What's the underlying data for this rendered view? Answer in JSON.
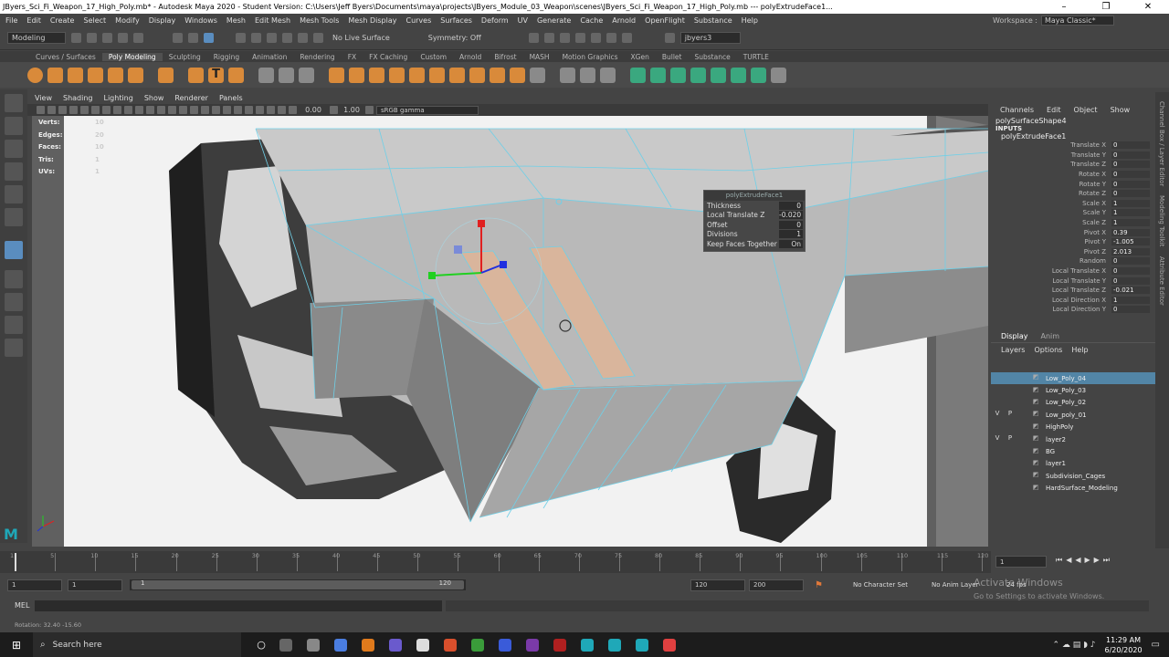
{
  "window": {
    "title": "JByers_Sci_Fi_Weapon_17_High_Poly.mb* - Autodesk Maya 2020 - Student Version: C:\\Users\\Jeff Byers\\Documents\\maya\\projects\\JByers_Module_03_Weapon\\scenes\\JByers_Sci_Fi_Weapon_17_High_Poly.mb --- polyExtrudeFace1..."
  },
  "menus": [
    "File",
    "Edit",
    "Create",
    "Select",
    "Modify",
    "Display",
    "Windows",
    "Mesh",
    "Edit Mesh",
    "Mesh Tools",
    "Mesh Display",
    "Curves",
    "Surfaces",
    "Deform",
    "UV",
    "Generate",
    "Cache",
    "Arnold",
    "OpenFlight",
    "Substance",
    "Help"
  ],
  "workspace": {
    "label": "Workspace :",
    "value": "Maya Classic*"
  },
  "status": {
    "mode": "Modeling",
    "live_surface": "No Live Surface",
    "symmetry": "Symmetry: Off",
    "user": "jbyers3"
  },
  "shelf_tabs": [
    "Curves / Surfaces",
    "Poly Modeling",
    "Sculpting",
    "Rigging",
    "Animation",
    "Rendering",
    "FX",
    "FX Caching",
    "Custom",
    "Arnold",
    "Bifrost",
    "MASH",
    "Motion Graphics",
    "XGen",
    "Bullet",
    "Substance",
    "TURTLE"
  ],
  "active_shelf": "Poly Modeling",
  "viewport_menu": [
    "View",
    "Shading",
    "Lighting",
    "Show",
    "Renderer",
    "Panels"
  ],
  "viewport_toolbar": {
    "val1": "0.00",
    "val2": "1.00",
    "color_space": "sRGB gamma"
  },
  "hud": [
    {
      "label": "Verts:",
      "value": "10"
    },
    {
      "label": "Edges:",
      "value": "20"
    },
    {
      "label": "Faces:",
      "value": "10"
    },
    {
      "label": "Tris:",
      "value": "1"
    },
    {
      "label": "UVs:",
      "value": "1"
    }
  ],
  "popup": {
    "title": "polyExtrudeFace1",
    "rows": [
      {
        "label": "Thickness",
        "value": "0"
      },
      {
        "label": "Local Translate Z",
        "value": "-0.020"
      },
      {
        "label": "Offset",
        "value": "0"
      },
      {
        "label": "Divisions",
        "value": "1"
      },
      {
        "label": "Keep Faces Together",
        "value": "On"
      }
    ]
  },
  "channel_box": {
    "menu": [
      "Channels",
      "Edit",
      "Object",
      "Show"
    ],
    "shape": "polySurfaceShape4",
    "inputs_label": "INPUTS",
    "node": "polyExtrudeFace1",
    "attrs": [
      {
        "name": "Translate X",
        "value": "0"
      },
      {
        "name": "Translate Y",
        "value": "0"
      },
      {
        "name": "Translate Z",
        "value": "0"
      },
      {
        "name": "Rotate X",
        "value": "0"
      },
      {
        "name": "Rotate Y",
        "value": "0"
      },
      {
        "name": "Rotate Z",
        "value": "0"
      },
      {
        "name": "Scale X",
        "value": "1"
      },
      {
        "name": "Scale Y",
        "value": "1"
      },
      {
        "name": "Scale Z",
        "value": "1"
      },
      {
        "name": "Pivot X",
        "value": "0.39"
      },
      {
        "name": "Pivot Y",
        "value": "-1.005"
      },
      {
        "name": "Pivot Z",
        "value": "2.013"
      },
      {
        "name": "Random",
        "value": "0"
      },
      {
        "name": "Local Translate X",
        "value": "0"
      },
      {
        "name": "Local Translate Y",
        "value": "0"
      },
      {
        "name": "Local Translate Z",
        "value": "-0.021"
      },
      {
        "name": "Local Direction X",
        "value": "1"
      },
      {
        "name": "Local Direction Y",
        "value": "0"
      }
    ]
  },
  "layer_editor": {
    "tabs": [
      "Display",
      "Anim"
    ],
    "menu": [
      "Layers",
      "Options",
      "Help"
    ],
    "layers": [
      {
        "name": "Low_Poly_04",
        "v": "",
        "p": "",
        "selected": true
      },
      {
        "name": "Low_Poly_03",
        "v": "",
        "p": ""
      },
      {
        "name": "Low_Poly_02",
        "v": "",
        "p": ""
      },
      {
        "name": "Low_poly_01",
        "v": "V",
        "p": "P"
      },
      {
        "name": "HighPoly",
        "v": "",
        "p": ""
      },
      {
        "name": "layer2",
        "v": "V",
        "p": "P"
      },
      {
        "name": "BG",
        "v": "",
        "p": ""
      },
      {
        "name": "layer1",
        "v": "",
        "p": ""
      },
      {
        "name": "Subdivision_Cages",
        "v": "",
        "p": ""
      },
      {
        "name": "HardSurface_Modeling",
        "v": "",
        "p": ""
      }
    ]
  },
  "side_tabs": [
    "Channel Box / Layer Editor",
    "Modeling Toolkit",
    "Attribute Editor"
  ],
  "timeline": {
    "ticks": [
      "1",
      "5",
      "10",
      "15",
      "20",
      "25",
      "30",
      "35",
      "40",
      "45",
      "50",
      "55",
      "60",
      "65",
      "70",
      "75",
      "80",
      "85",
      "90",
      "95",
      "100",
      "105",
      "110",
      "115",
      "120"
    ],
    "current": "1"
  },
  "range": {
    "start": "1",
    "inner_start": "1",
    "slider_start": "1",
    "slider_end": "120",
    "end": "120",
    "max": "200",
    "character_set": "No Character Set",
    "anim_layer": "No Anim Layer",
    "fps": "24 fps"
  },
  "mel_label": "MEL",
  "helpline": "Rotation:  32.40      -15.60",
  "watermark": {
    "line1": "Activate Windows",
    "line2": "Go to Settings to activate Windows."
  },
  "taskbar": {
    "search": "Search here",
    "time": "11:29 AM",
    "date": "6/20/2020"
  }
}
